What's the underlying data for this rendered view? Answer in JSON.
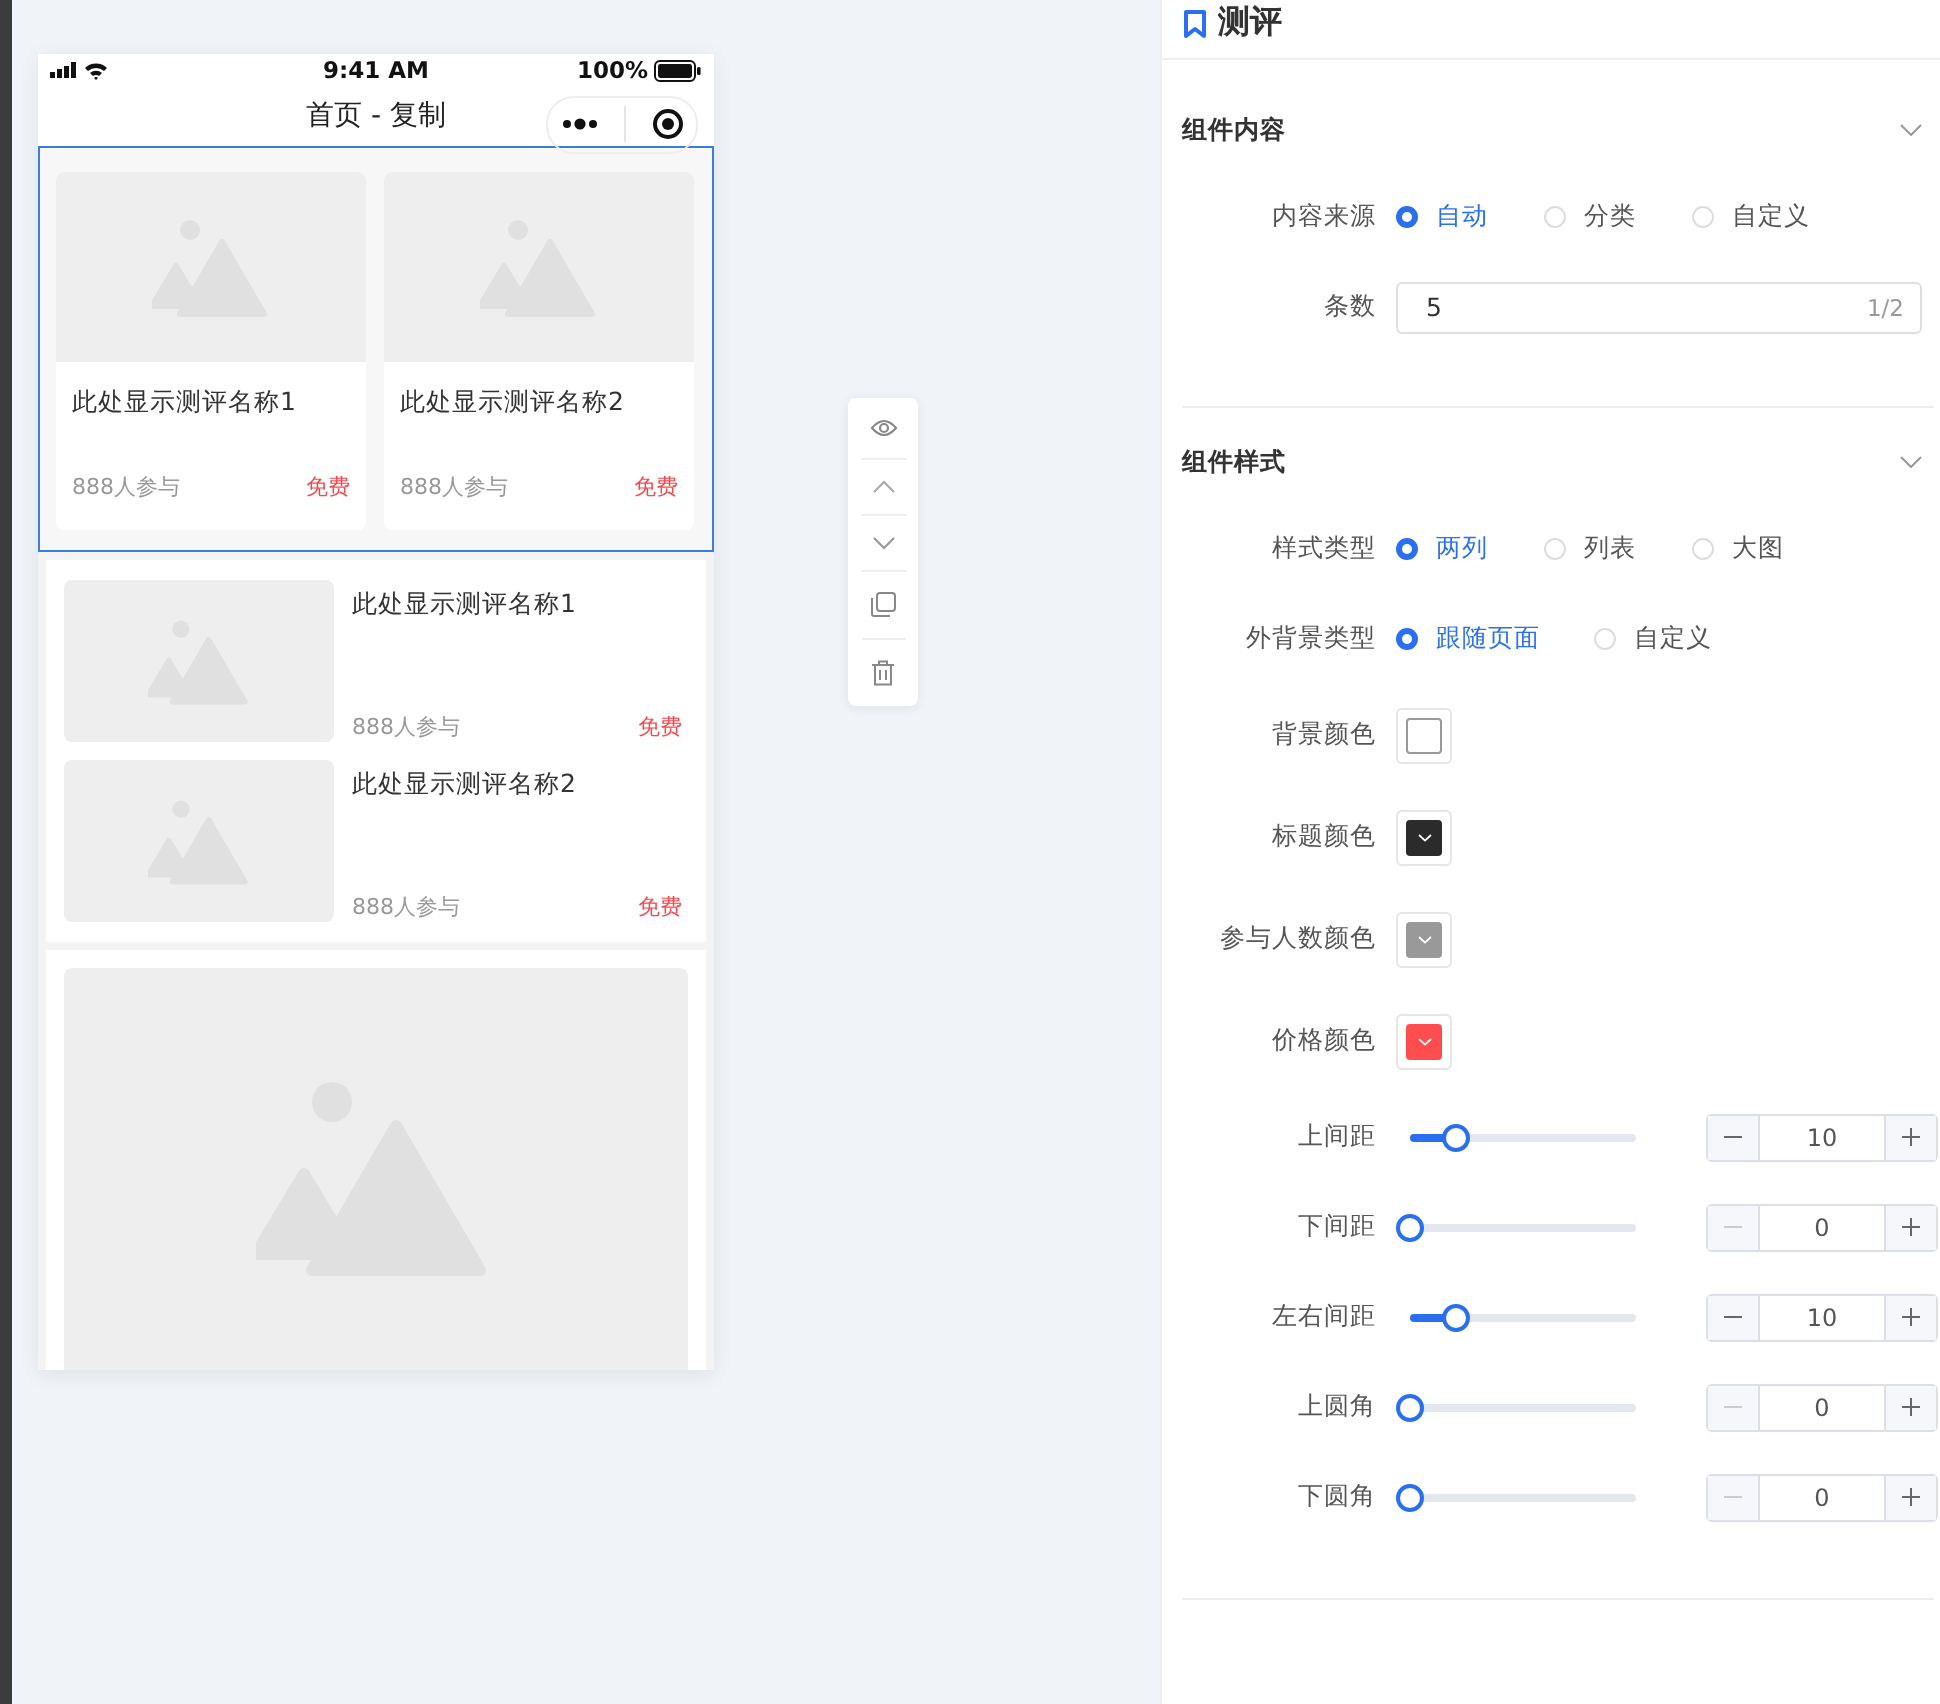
{
  "phone": {
    "status_bar": {
      "time": "9:41 AM",
      "battery": "100%"
    },
    "nav_title": "首页 - 复制",
    "blocks": [
      {
        "kind": "two-column",
        "selected": true,
        "items": [
          {
            "title": "此处显示测评名称1",
            "participants": "888人参与",
            "price": "免费"
          },
          {
            "title": "此处显示测评名称2",
            "participants": "888人参与",
            "price": "免费"
          }
        ]
      },
      {
        "kind": "list",
        "selected": false,
        "items": [
          {
            "title": "此处显示测评名称1",
            "participants": "888人参与",
            "price": "免费"
          },
          {
            "title": "此处显示测评名称2",
            "participants": "888人参与",
            "price": "免费"
          }
        ]
      },
      {
        "kind": "big-image",
        "selected": false
      }
    ]
  },
  "panel": {
    "title": "测评",
    "sections": [
      {
        "title": "组件内容",
        "rows": [
          {
            "kind": "radio",
            "label": "内容来源",
            "options": [
              {
                "label": "自动",
                "selected": true
              },
              {
                "label": "分类",
                "selected": false
              },
              {
                "label": "自定义",
                "selected": false
              }
            ]
          },
          {
            "kind": "text",
            "label": "条数",
            "value": "5",
            "counter": "1/2"
          }
        ]
      },
      {
        "title": "组件样式",
        "rows": [
          {
            "kind": "radio",
            "label": "样式类型",
            "options": [
              {
                "label": "两列",
                "selected": true
              },
              {
                "label": "列表",
                "selected": false
              },
              {
                "label": "大图",
                "selected": false
              }
            ]
          },
          {
            "kind": "radio",
            "label": "外背景类型",
            "options": [
              {
                "label": "跟随页面",
                "selected": true
              },
              {
                "label": "自定义",
                "selected": false
              }
            ]
          },
          {
            "kind": "color",
            "label": "背景颜色",
            "chevron": false,
            "color": "#ffffff"
          },
          {
            "kind": "color",
            "label": "标题颜色",
            "chevron": true,
            "color": "#2b2b2b"
          },
          {
            "kind": "color",
            "label": "参与人数颜色",
            "chevron": true,
            "color": "#999999"
          },
          {
            "kind": "color",
            "label": "价格颜色",
            "chevron": true,
            "color": "#ff4d4f"
          },
          {
            "kind": "slider",
            "label": "上间距",
            "level": 0.2,
            "value": "10",
            "minus_disabled": false
          },
          {
            "kind": "slider",
            "label": "下间距",
            "level": 0,
            "value": "0",
            "minus_disabled": true
          },
          {
            "kind": "slider",
            "label": "左右间距",
            "level": 0.2,
            "value": "10",
            "minus_disabled": false
          },
          {
            "kind": "slider",
            "label": "上圆角",
            "level": 0,
            "value": "0",
            "minus_disabled": true
          },
          {
            "kind": "slider",
            "label": "下圆角",
            "level": 0,
            "value": "0",
            "minus_disabled": true
          }
        ]
      }
    ]
  }
}
